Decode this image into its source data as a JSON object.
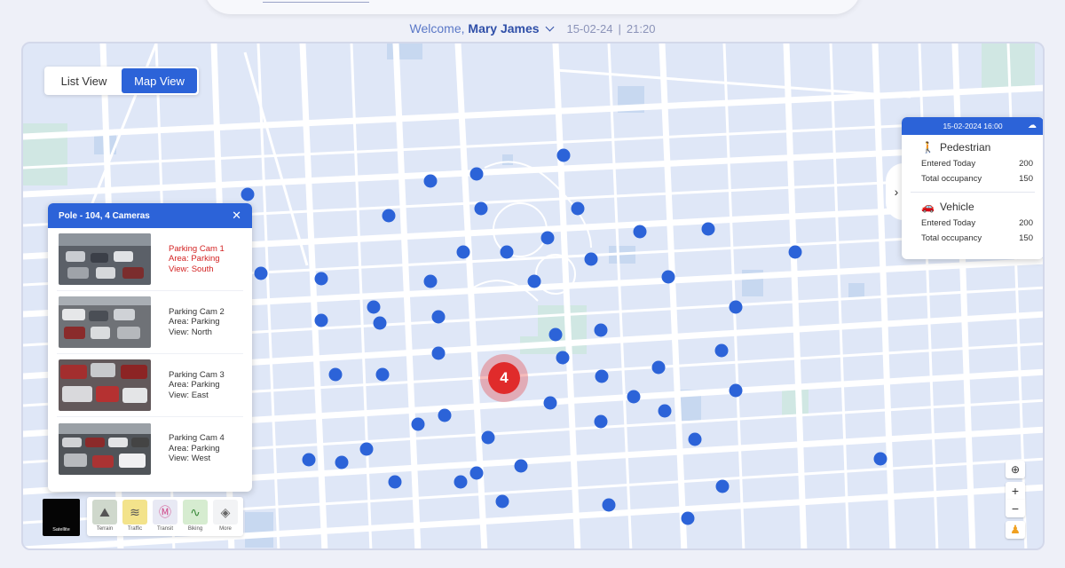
{
  "header": {
    "welcome_prefix": "Welcome,",
    "user_name": "Mary James",
    "date": "15-02-24",
    "separator": "|",
    "time": "21:20"
  },
  "view_toggle": {
    "list_label": "List View",
    "map_label": "Map View",
    "active": "Map View"
  },
  "pole_panel": {
    "title": "Pole - 104, 4 Cameras",
    "close_icon": "close-icon",
    "cameras": [
      {
        "name": "Parking Cam 1",
        "area": "Area: Parking",
        "view": "View: South",
        "alert": true
      },
      {
        "name": "Parking Cam 2",
        "area": "Area: Parking",
        "view": "View: North",
        "alert": false
      },
      {
        "name": "Parking Cam 3",
        "area": "Area: Parking",
        "view": "View: East",
        "alert": false
      },
      {
        "name": "Parking Cam 4",
        "area": "Area: Parking",
        "view": "View: West",
        "alert": false
      }
    ]
  },
  "stats_card": {
    "datetime": "15-02-2024 16:00",
    "weather_icon": "cloud-sun-icon",
    "pedestrian": {
      "title": "Pedestrian",
      "entered_label": "Entered Today",
      "entered_value": "200",
      "occupancy_label": "Total occupancy",
      "occupancy_value": "150"
    },
    "vehicle": {
      "title": "Vehicle",
      "entered_label": "Entered Today",
      "entered_value": "200",
      "occupancy_label": "Total occupancy",
      "occupancy_value": "150"
    }
  },
  "cluster": {
    "count": "4"
  },
  "layers": {
    "satellite_label": "Satellite",
    "options": [
      "Terrain",
      "Traffic",
      "Transit",
      "Biking",
      "More"
    ]
  },
  "colors": {
    "accent": "#2c63d8",
    "marker": "#2c63d8",
    "alert": "#d32222",
    "cluster": "#e02b2b"
  }
}
